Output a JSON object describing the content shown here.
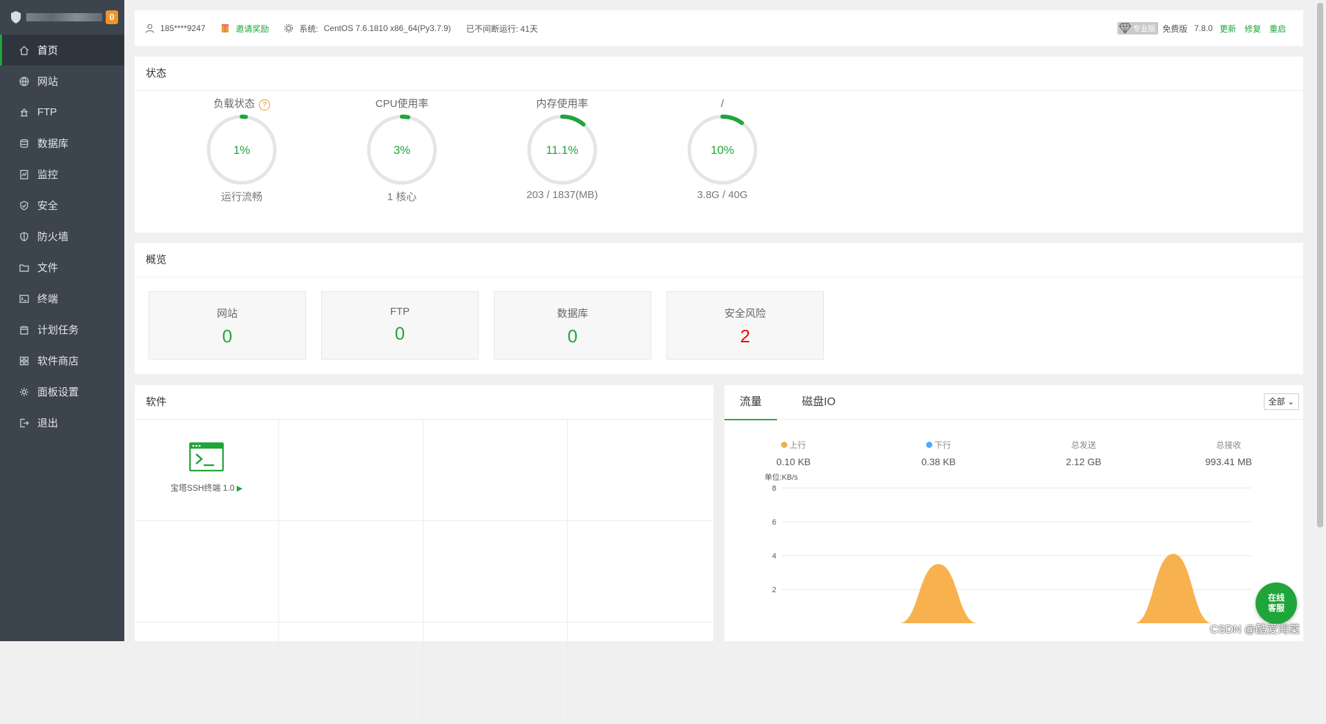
{
  "sidebar": {
    "badge": "0",
    "items": [
      {
        "label": "首页",
        "icon": "home-icon"
      },
      {
        "label": "网站",
        "icon": "globe-icon"
      },
      {
        "label": "FTP",
        "icon": "ftp-icon"
      },
      {
        "label": "数据库",
        "icon": "database-icon"
      },
      {
        "label": "监控",
        "icon": "monitor-icon"
      },
      {
        "label": "安全",
        "icon": "shield-check-icon"
      },
      {
        "label": "防火墙",
        "icon": "firewall-icon"
      },
      {
        "label": "文件",
        "icon": "folder-icon"
      },
      {
        "label": "终端",
        "icon": "terminal-icon"
      },
      {
        "label": "计划任务",
        "icon": "calendar-icon"
      },
      {
        "label": "软件商店",
        "icon": "apps-icon"
      },
      {
        "label": "面板设置",
        "icon": "gear-icon"
      },
      {
        "label": "退出",
        "icon": "logout-icon"
      }
    ]
  },
  "topbar": {
    "user": "185****9247",
    "invite": "邀请奖励",
    "system_label": "系统:",
    "system_value": "CentOS 7.6.1810 x86_64(Py3.7.9)",
    "uptime": "已不间断运行: 41天",
    "pro_badge": "专业版",
    "edition": "免费版",
    "version": "7.8.0",
    "update": "更新",
    "repair": "修复",
    "restart": "重启"
  },
  "status": {
    "title": "状态",
    "gauges": [
      {
        "label": "负载状态",
        "value": "1%",
        "percent": 1,
        "footer": "运行流畅",
        "help": "?"
      },
      {
        "label": "CPU使用率",
        "value": "3%",
        "percent": 3,
        "footer": "1 核心"
      },
      {
        "label": "内存使用率",
        "value": "11.1%",
        "percent": 11.1,
        "footer": "203 / 1837(MB)"
      },
      {
        "label": "/",
        "value": "10%",
        "percent": 10,
        "footer": "3.8G / 40G"
      }
    ]
  },
  "overview": {
    "title": "概览",
    "cards": [
      {
        "label": "网站",
        "value": "0"
      },
      {
        "label": "FTP",
        "value": "0"
      },
      {
        "label": "数据库",
        "value": "0"
      },
      {
        "label": "安全风险",
        "value": "2"
      }
    ]
  },
  "software": {
    "title": "软件",
    "app_name": "宝塔SSH终端 1.0",
    "play": "▶"
  },
  "traffic": {
    "tabs": [
      "流量",
      "磁盘IO"
    ],
    "select": "全部",
    "stats": [
      {
        "label": "上行",
        "value": "0.10 KB",
        "dot": "#f0ad4e"
      },
      {
        "label": "下行",
        "value": "0.38 KB",
        "dot": "#52a9ff"
      },
      {
        "label": "总发送",
        "value": "2.12 GB"
      },
      {
        "label": "总接收",
        "value": "993.41 MB"
      }
    ]
  },
  "chart_data": {
    "type": "area",
    "ylabel": "单位:KB/s",
    "yticks": [
      "8",
      "6",
      "4",
      "2"
    ],
    "ylim": [
      0,
      8
    ],
    "series": [
      {
        "values": [
          0,
          0,
          0,
          0,
          3.5,
          0,
          0,
          0,
          0,
          0,
          4.1,
          0,
          0
        ]
      }
    ],
    "grid": true
  },
  "chat": {
    "line1": "在线",
    "line2": "客服"
  },
  "watermark": "CSDN @酷爱海棠",
  "colors": {
    "accent": "#20a53a",
    "sidebar": "#3c444d",
    "danger": "#ef0808",
    "area": "#f7b24f"
  }
}
